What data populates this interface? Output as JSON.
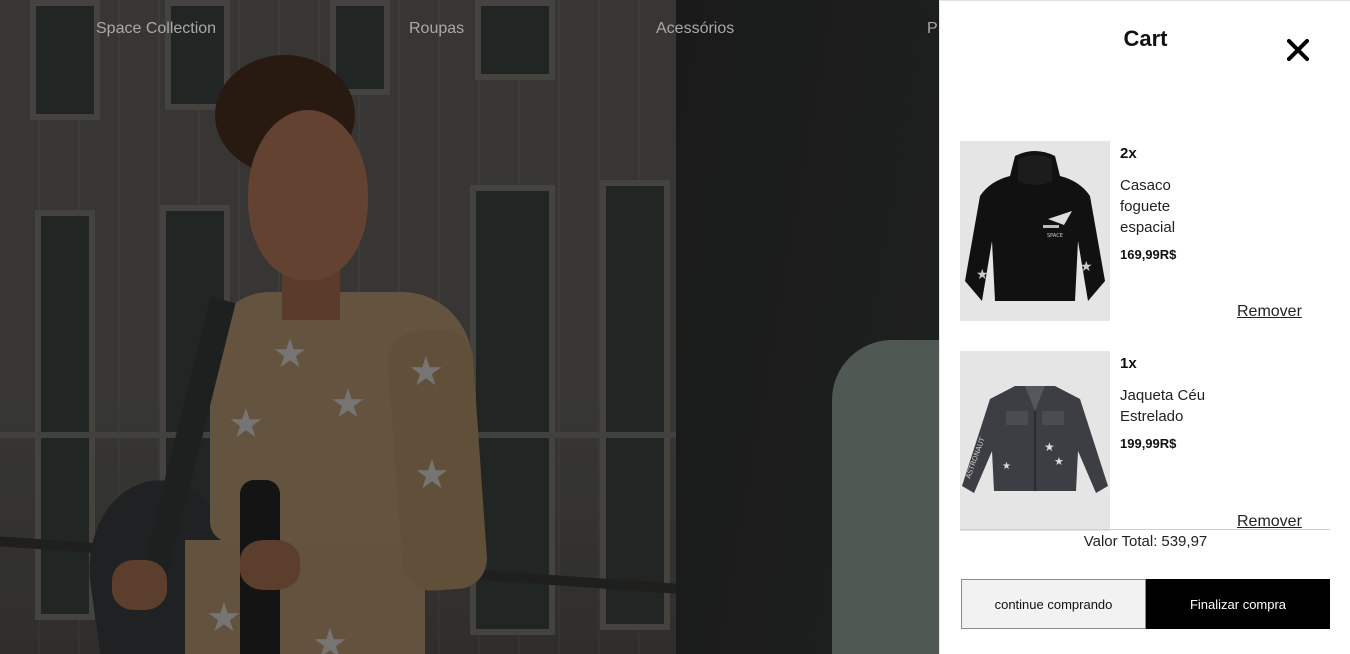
{
  "nav": {
    "links": [
      "Space Collection",
      "Roupas",
      "Acessórios",
      "P"
    ]
  },
  "cart": {
    "title": "Cart",
    "items": [
      {
        "quantity": "2x",
        "name": "Casaco foguete espacial",
        "price": "169,99R$",
        "remove_label": "Remover",
        "print_label": "SPACE"
      },
      {
        "quantity": "1x",
        "name": "Jaqueta Céu Estrelado",
        "price": "199,99R$",
        "remove_label": "Remover",
        "print_label": "ASTRONAUT"
      }
    ],
    "total_label": "Valor Total:",
    "total_value": "539,97",
    "continue_label": "continue comprando",
    "checkout_label": "Finalizar compra"
  },
  "colors": {
    "checkout_bg": "#000000",
    "continue_bg": "#f2f2f2",
    "nav_text": "#a9a9a9"
  }
}
